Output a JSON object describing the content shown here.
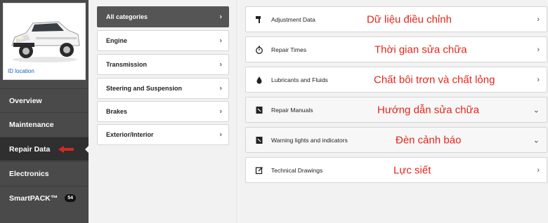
{
  "sidebar": {
    "vehicle": {
      "id_location_label": "ID location"
    },
    "nav": [
      {
        "label": "Overview"
      },
      {
        "label": "Maintenance"
      },
      {
        "label": "Repair Data",
        "active": true
      },
      {
        "label": "Electronics"
      },
      {
        "label": "SmartPACK™",
        "badge": "54"
      }
    ]
  },
  "categories": [
    {
      "label": "All categories",
      "active": true
    },
    {
      "label": "Engine"
    },
    {
      "label": "Transmission"
    },
    {
      "label": "Steering and Suspension"
    },
    {
      "label": "Brakes"
    },
    {
      "label": "Exterior/Interior"
    }
  ],
  "data_items": [
    {
      "icon": "wrench-icon",
      "label": "Adjustment Data",
      "annotation": "Dữ liệu điều chỉnh",
      "chevron": "right"
    },
    {
      "icon": "stopwatch-icon",
      "label": "Repair Times",
      "annotation": "Thời gian sửa chữa",
      "chevron": "right"
    },
    {
      "icon": "oil-drop-icon",
      "label": "Lubricants and Fluids",
      "annotation": "Chất bôi trơn và chất lỏng",
      "chevron": "right"
    },
    {
      "icon": "manual-icon",
      "label": "Repair Manuals",
      "annotation": "Hướng dẫn sửa chữa",
      "chevron": "down"
    },
    {
      "icon": "warning-light-icon",
      "label": "Warning lights and indicators",
      "annotation": "Đèn cảnh báo",
      "chevron": "down"
    },
    {
      "icon": "drawing-icon",
      "label": "Technical Drawings",
      "annotation": "Lực siết",
      "chevron": "right"
    }
  ],
  "colors": {
    "sidebar_bg": "#4a4a4a",
    "active_nav": "#2f2f2f",
    "annotation_red": "#e3261b",
    "active_category": "#555555"
  }
}
